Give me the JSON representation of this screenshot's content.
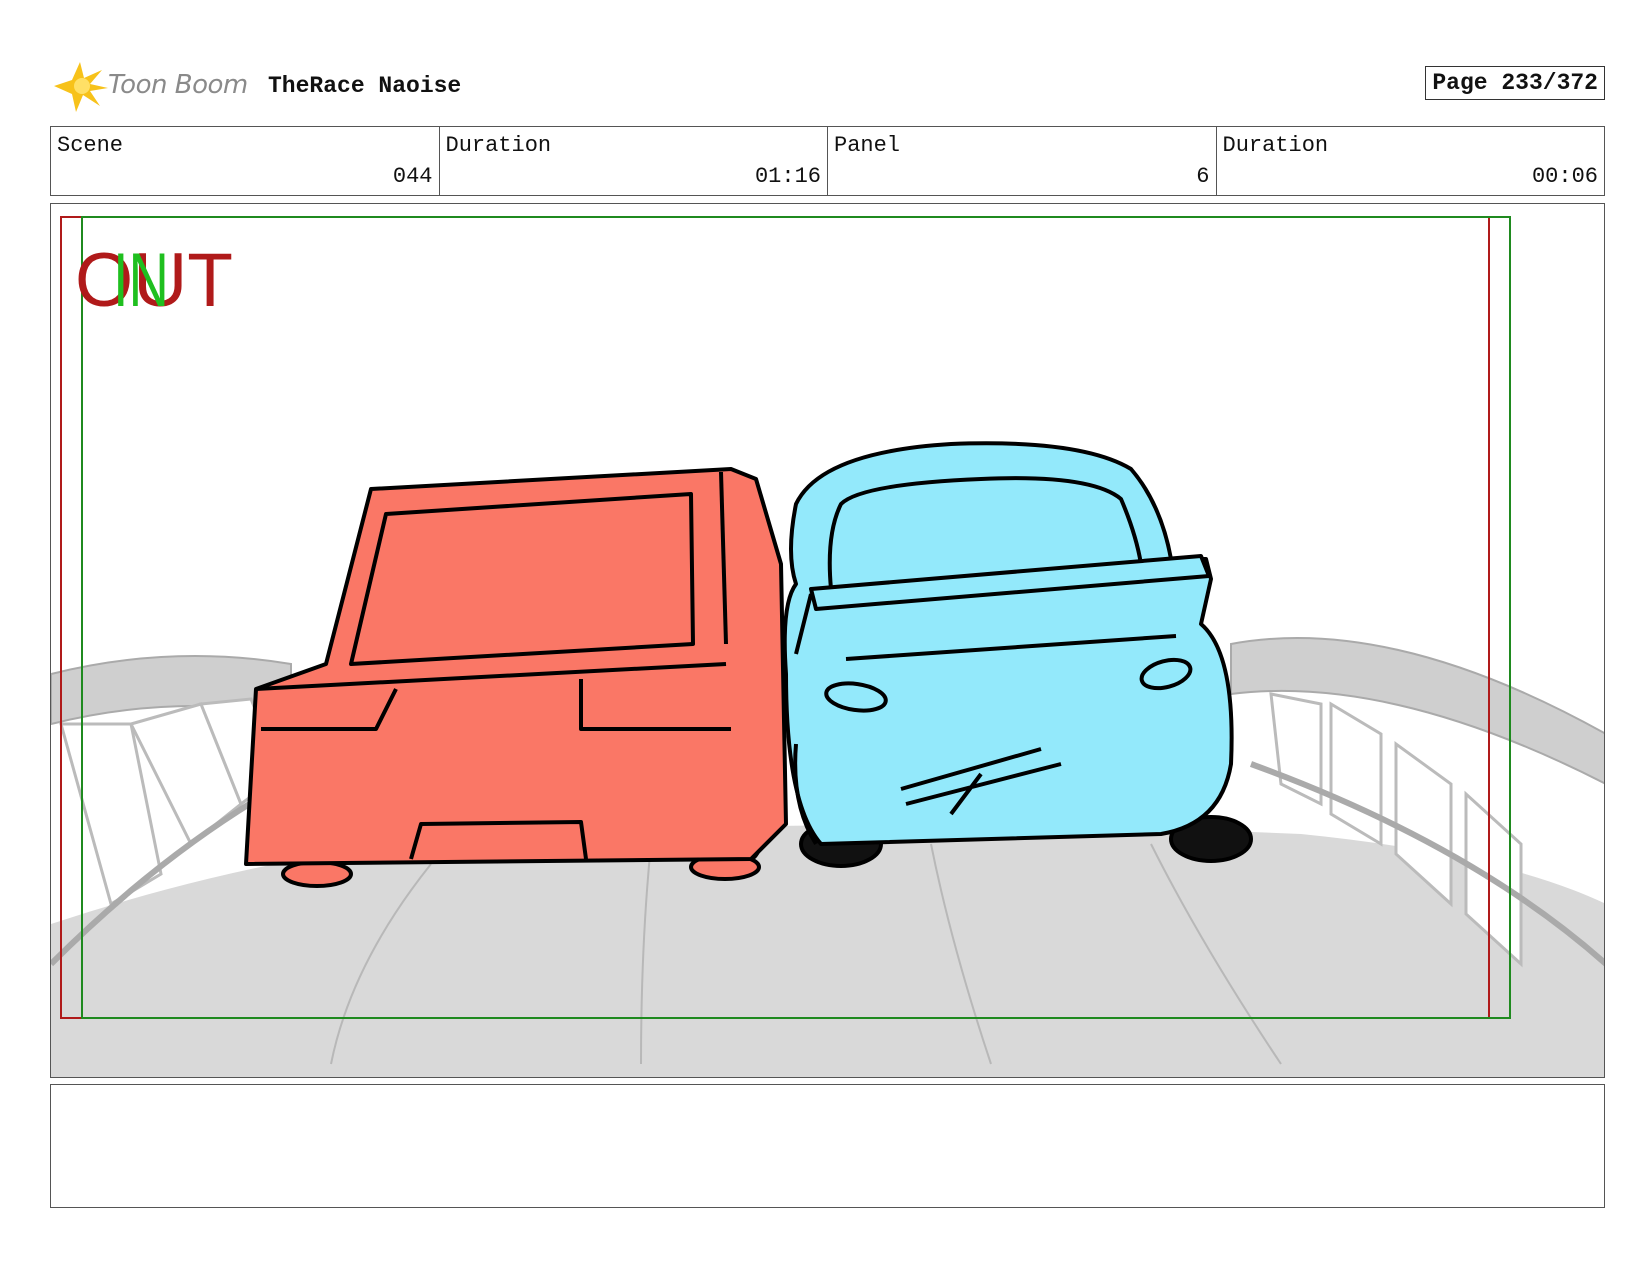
{
  "header": {
    "logo_text": "Toon Boom",
    "project_title": "TheRace Naoise",
    "page_label": "Page 233/372"
  },
  "info": [
    {
      "label": "Scene",
      "value": "044"
    },
    {
      "label": "Duration",
      "value": "01:16"
    },
    {
      "label": "Panel",
      "value": "6"
    },
    {
      "label": "Duration",
      "value": "00:06"
    }
  ],
  "panel": {
    "out_marker": "OUT",
    "in_marker": "IN",
    "colors": {
      "out_frame": "#b01a1a",
      "in_frame": "#1f8a1f",
      "red_car": "#fa7766",
      "blue_car": "#93e9fb",
      "road": "#d9d9d9"
    }
  },
  "notes": {
    "text": ""
  }
}
